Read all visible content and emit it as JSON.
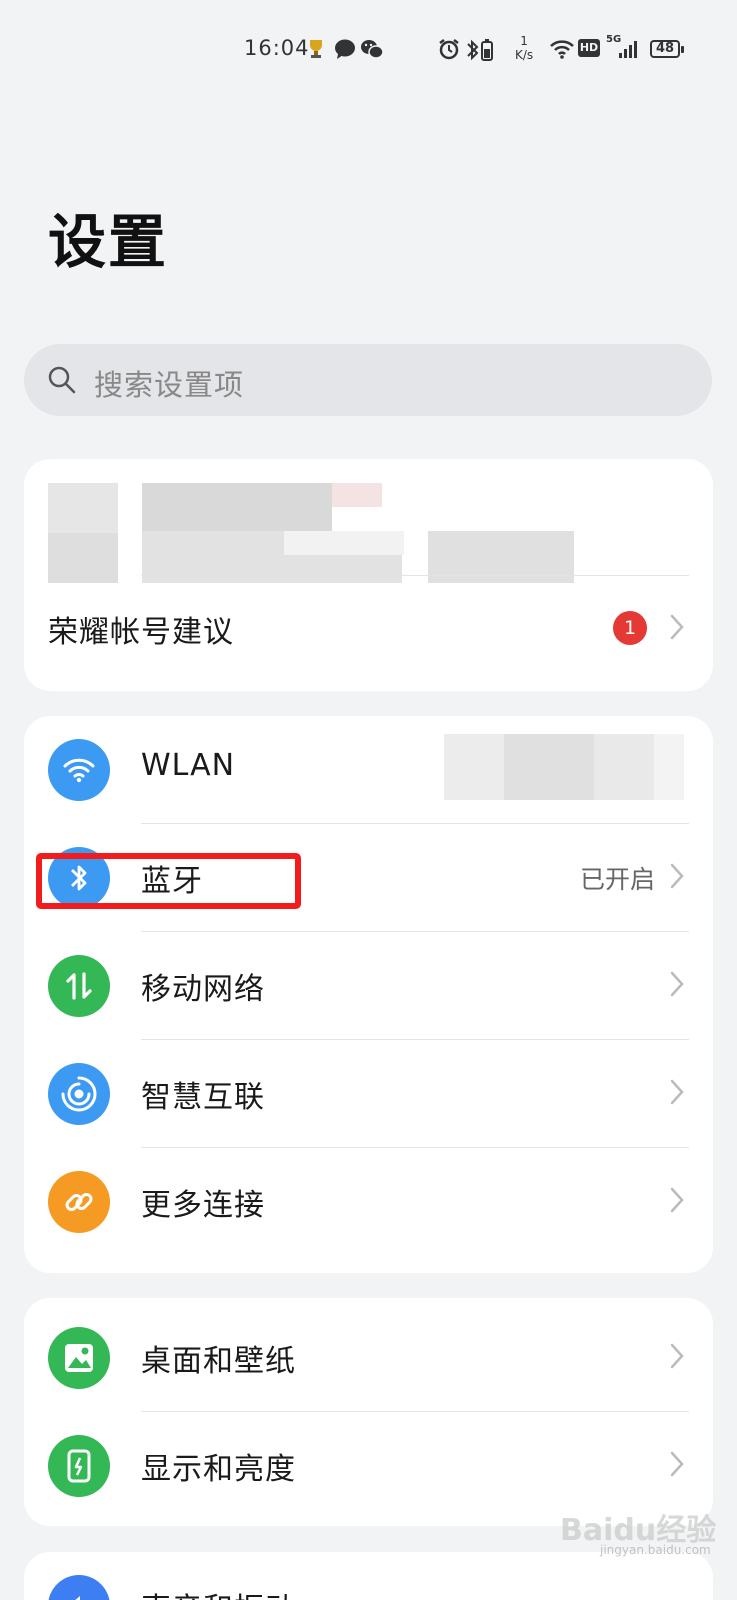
{
  "status_bar": {
    "time": "16:04",
    "net_speed_value": "1",
    "net_speed_unit": "K/s",
    "network": "5G",
    "hd": "HD",
    "battery": "48"
  },
  "page": {
    "title": "设置"
  },
  "search": {
    "placeholder": "搜索设置项"
  },
  "account": {
    "suggestion_label": "荣耀帐号建议",
    "suggestion_badge": "1"
  },
  "connectivity": {
    "items": [
      {
        "label": "WLAN",
        "value": "",
        "icon": "wifi-icon",
        "color": "#3d9af2"
      },
      {
        "label": "蓝牙",
        "value": "已开启",
        "icon": "bluetooth-icon",
        "color": "#3d9af2"
      },
      {
        "label": "移动网络",
        "value": "",
        "icon": "mobile-data-icon",
        "color": "#34b856"
      },
      {
        "label": "智慧互联",
        "value": "",
        "icon": "smart-connect-icon",
        "color": "#3d9af2"
      },
      {
        "label": "更多连接",
        "value": "",
        "icon": "link-icon",
        "color": "#f59a23"
      }
    ]
  },
  "display": {
    "items": [
      {
        "label": "桌面和壁纸",
        "icon": "wallpaper-icon",
        "color": "#34b856"
      },
      {
        "label": "显示和亮度",
        "icon": "brightness-icon",
        "color": "#34b856"
      }
    ]
  },
  "sound": {
    "items": [
      {
        "label": "声音和振动",
        "icon": "sound-icon",
        "color": "#3d7ef2"
      }
    ]
  },
  "watermark": {
    "brand": "Baidu经验",
    "url": "jingyan.baidu.com"
  }
}
